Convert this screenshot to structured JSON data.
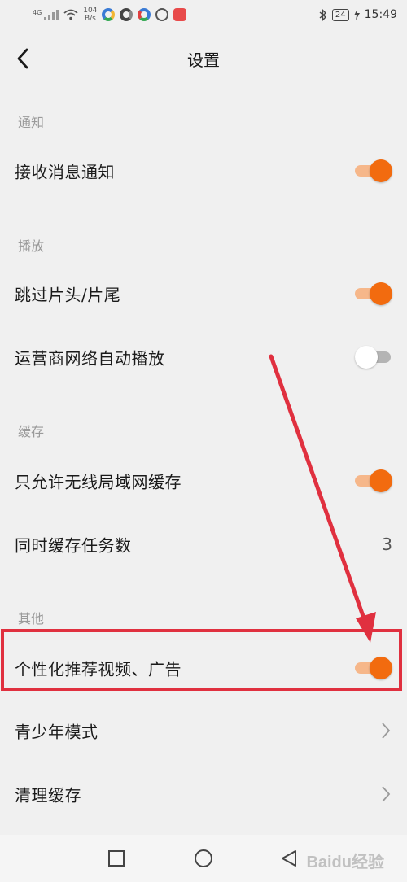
{
  "status_bar": {
    "net_type": "4G",
    "speed_top": "104",
    "speed_bottom": "B/s",
    "battery": "24",
    "time": "15:49",
    "icons": [
      "signal-icon",
      "wifi-icon",
      "bluetooth-icon",
      "battery-icon"
    ]
  },
  "header": {
    "title": "设置",
    "back_icon": "chevron-left-icon"
  },
  "sections": {
    "notify": {
      "label": "通知",
      "rows": {
        "receive": {
          "label": "接收消息通知",
          "toggle": "on"
        }
      }
    },
    "playback": {
      "label": "播放",
      "rows": {
        "skip": {
          "label": "跳过片头/片尾",
          "toggle": "on"
        },
        "carrier": {
          "label": "运营商网络自动播放",
          "toggle": "off"
        }
      }
    },
    "cache": {
      "label": "缓存",
      "rows": {
        "wlan_only": {
          "label": "只允许无线局域网缓存",
          "toggle": "on"
        },
        "concurrent": {
          "label": "同时缓存任务数",
          "value": "3"
        }
      }
    },
    "other": {
      "label": "其他",
      "rows": {
        "personalized": {
          "label": "个性化推荐视频、广告",
          "toggle": "on"
        },
        "teen": {
          "label": "青少年模式"
        },
        "clear": {
          "label": "清理缓存"
        }
      }
    }
  },
  "colors": {
    "toggle_on": "#f26b0f",
    "toggle_on_track": "#f6b78a",
    "annotation": "#e0303f",
    "background": "#f0f0f0"
  },
  "watermark": "Baidu经验"
}
